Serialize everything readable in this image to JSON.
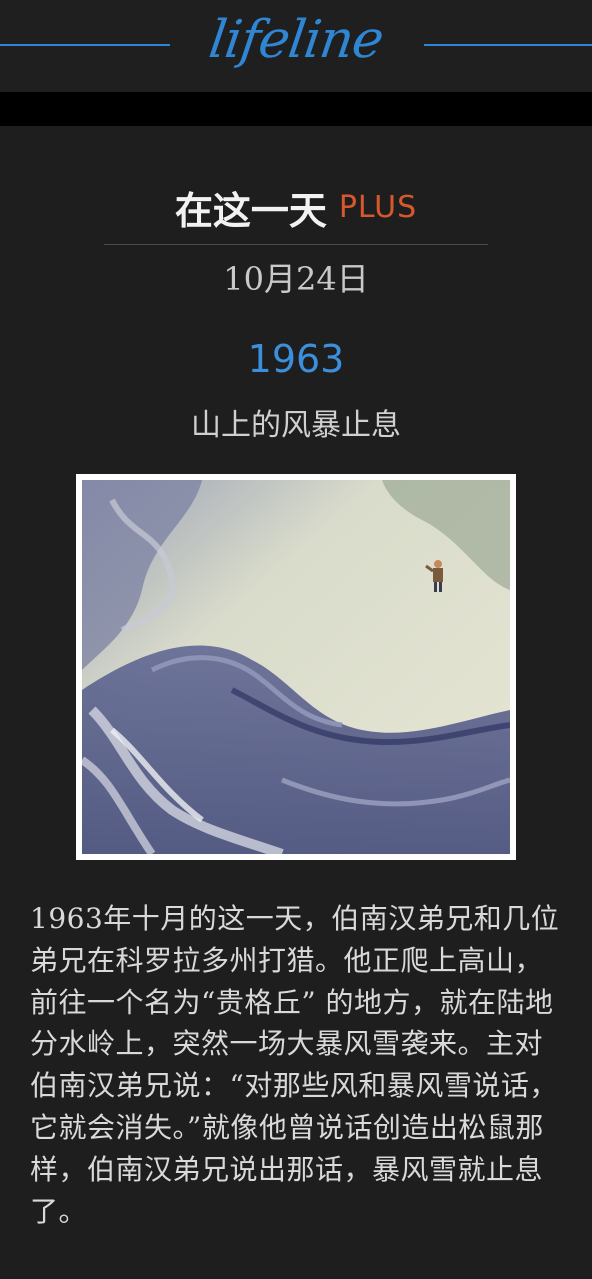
{
  "header": {
    "logo_text": "lifeline",
    "accent_color": "#2f86d3"
  },
  "title": {
    "main": "在这一天",
    "plus": "PLUS",
    "plus_color": "#d8582d"
  },
  "date": "10月24日",
  "event": {
    "year": "1963",
    "year_color": "#3b8fdb",
    "headline": "山上的风暴止息",
    "image": {
      "icon": "storm-painting-image"
    },
    "body": "1963年十月的这一天，伯南汉弟兄和几位弟兄在科罗拉多州打猎。他正爬上高山，前往一个名为“贵格丘” 的地方，就在陆地分水岭上，突然一场大暴风雪袭来。主对伯南汉弟兄说：“对那些风和暴风雪说话，它就会消失。”就像他曾说话创造出松鼠那样，伯南汉弟兄说出那话，暴风雪就止息了。"
  }
}
